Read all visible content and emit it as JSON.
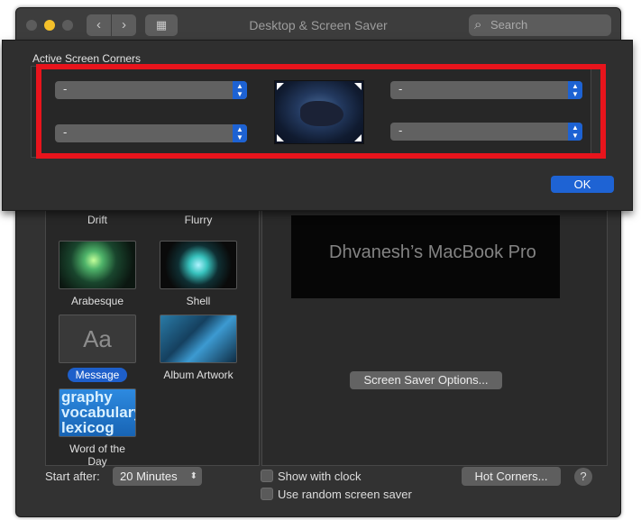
{
  "window": {
    "title": "Desktop & Screen Saver",
    "back_icon": "‹",
    "forward_icon": "›",
    "grid_icon": "▦",
    "search_placeholder": "Search"
  },
  "screen_savers": [
    {
      "label": "Drift"
    },
    {
      "label": "Flurry"
    },
    {
      "label": "Arabesque"
    },
    {
      "label": "Shell"
    },
    {
      "label": "Message",
      "thumb_text": "Aa",
      "selected": true
    },
    {
      "label": "Album Artwork"
    },
    {
      "label": "Word of the Day",
      "thumb_text": "graphy vocabulary lexicog"
    }
  ],
  "preview": {
    "text": "Dhvanesh’s MacBook Pro"
  },
  "buttons": {
    "screen_saver_options": "Screen Saver Options...",
    "hot_corners": "Hot Corners...",
    "help": "?",
    "ok": "OK"
  },
  "start_after": {
    "label": "Start after:",
    "value": "20 Minutes"
  },
  "checkboxes": {
    "show_with_clock": {
      "label": "Show with clock",
      "checked": false
    },
    "random_screen_saver": {
      "label": "Use random screen saver",
      "checked": false
    }
  },
  "sheet": {
    "title": "Active Screen Corners",
    "corners": {
      "top_left": "-",
      "top_right": "-",
      "bottom_left": "-",
      "bottom_right": "-"
    }
  },
  "colors": {
    "accent": "#1e63d4",
    "highlight": "#e8141c",
    "window_bg": "#323232"
  }
}
